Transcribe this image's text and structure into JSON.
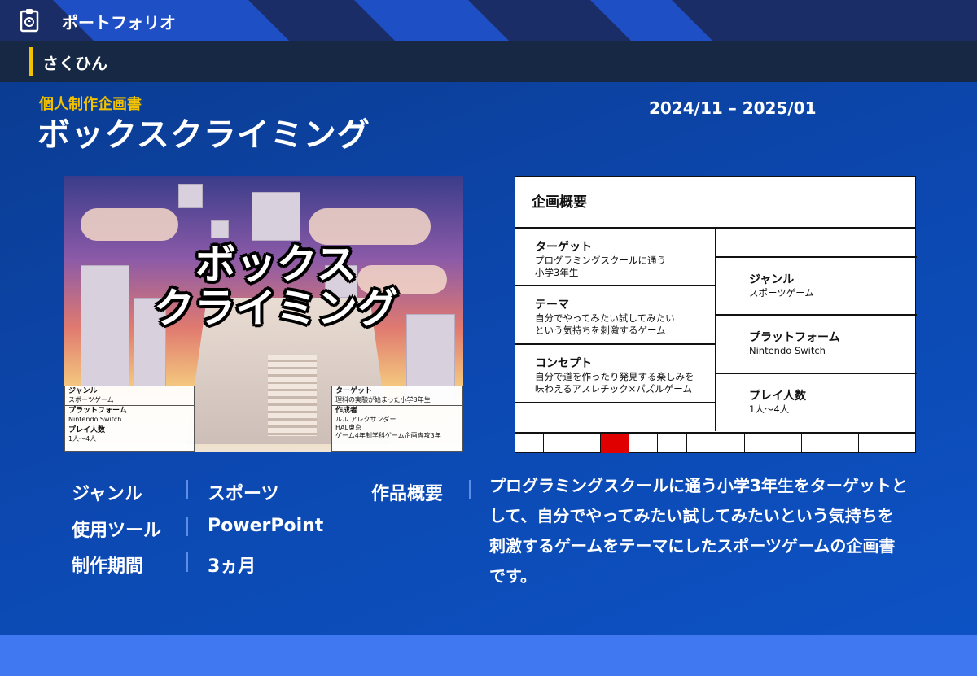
{
  "header": {
    "title": "ポートフォリオ",
    "logo_icon": "clipboard-logo-icon"
  },
  "section": {
    "label": "さくひん"
  },
  "project": {
    "subtitle": "個人制作企画書",
    "title": "ボックスクライミング",
    "period": "2024/11 – 2025/01"
  },
  "cover": {
    "logo_line1": "ボックス",
    "logo_line2": "クライミング",
    "left_box": [
      {
        "label": "ジャンル",
        "value": "スポーツゲーム"
      },
      {
        "label": "プラットフォーム",
        "value": "Nintendo Switch"
      },
      {
        "label": "プレイ人数",
        "value": "1人〜4人"
      }
    ],
    "right_box": [
      {
        "label": "ターゲット",
        "value": "理科の実験が始まった小学3年生"
      },
      {
        "label": "作成者",
        "value_lines": [
          "ルル アレクサンダー",
          "HAL東京",
          "ゲーム4年制学科ゲーム企画専攻3年"
        ]
      }
    ]
  },
  "overview": {
    "title": "企画概要",
    "left": [
      {
        "label": "ターゲット",
        "lines": [
          "プログラミングスクールに通う",
          "小学3年生"
        ]
      },
      {
        "label": "テーマ",
        "lines": [
          "自分でやってみたい試してみたい",
          "という気持ちを刺激するゲーム"
        ]
      },
      {
        "label": "コンセプト",
        "lines": [
          "自分で道を作ったり発見する楽しみを",
          "味わえるアスレチック×パズルゲーム"
        ]
      }
    ],
    "right": [
      {
        "label": "ジャンル",
        "value": "スポーツゲーム"
      },
      {
        "label": "プラットフォーム",
        "value": "Nintendo Switch"
      },
      {
        "label": "プレイ人数",
        "value": "1人〜4人"
      }
    ],
    "accent_color": "#e00000"
  },
  "meta": {
    "items": [
      {
        "label": "ジャンル",
        "value": "スポーツ"
      },
      {
        "label": "使用ツール",
        "value": "PowerPoint"
      },
      {
        "label": "制作期間",
        "value": "3ヵ月"
      }
    ],
    "summary_label": "作品概要",
    "summary_lines": [
      "プログラミングスクールに通う小学3年生をターゲットと",
      "して、自分でやってみたい試してみたいという気持ちを",
      "刺激するゲームをテーマにしたスポーツゲームの企画書",
      "です。"
    ]
  },
  "colors": {
    "accent_yellow": "#f2c200",
    "header_blue": "#1f4fc4",
    "section_navy": "#172844",
    "footer_blue": "#3f78f0"
  }
}
